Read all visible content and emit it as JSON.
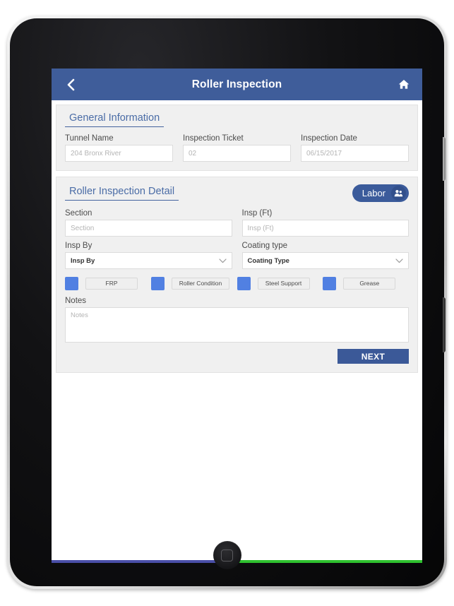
{
  "app": {
    "header": {
      "title": "Roller Inspection",
      "back_icon": "chevron-left-icon",
      "home_icon": "home-icon",
      "bar_color": "#3f5d9a"
    }
  },
  "general_information": {
    "section_title": "General Information",
    "fields": [
      {
        "label": "Tunnel Name",
        "value": "204 Bronx River"
      },
      {
        "label": "Inspection Ticket",
        "value": "02"
      },
      {
        "label": "Inspection Date",
        "value": "06/15/2017"
      }
    ]
  },
  "roller_inspection_detail": {
    "section_title": "Roller Inspection Detail",
    "labor_button": {
      "label": "Labor",
      "icon": "users-icon",
      "color": "#3b5b9b"
    },
    "fields": {
      "section": {
        "label": "Section",
        "placeholder": "Section",
        "value": ""
      },
      "insp_ft": {
        "label": "Insp (Ft)",
        "placeholder": "Insp (Ft)",
        "value": ""
      },
      "insp_by": {
        "label": "Insp By",
        "selected": "Insp By",
        "chevron": "chevron-down-icon"
      },
      "coating_type": {
        "label": "Coating type",
        "selected": "Coating Type",
        "chevron": "chevron-down-icon"
      }
    },
    "toggles": [
      {
        "label": "FRP",
        "swatch_color": "#5180e2"
      },
      {
        "label": "Roller Condition",
        "swatch_color": "#5180e2"
      },
      {
        "label": "Steel Support",
        "swatch_color": "#5180e2"
      },
      {
        "label": "Grease",
        "swatch_color": "#5180e2"
      }
    ],
    "notes": {
      "label": "Notes",
      "placeholder": "Notes",
      "value": ""
    },
    "next_button": {
      "label": "NEXT",
      "color": "#3b5998"
    }
  },
  "status_bars": {
    "left_color": "#4a4fa8",
    "right_color": "#2fc12f"
  },
  "device": {
    "home_button_icon": "rounded-square-icon"
  }
}
